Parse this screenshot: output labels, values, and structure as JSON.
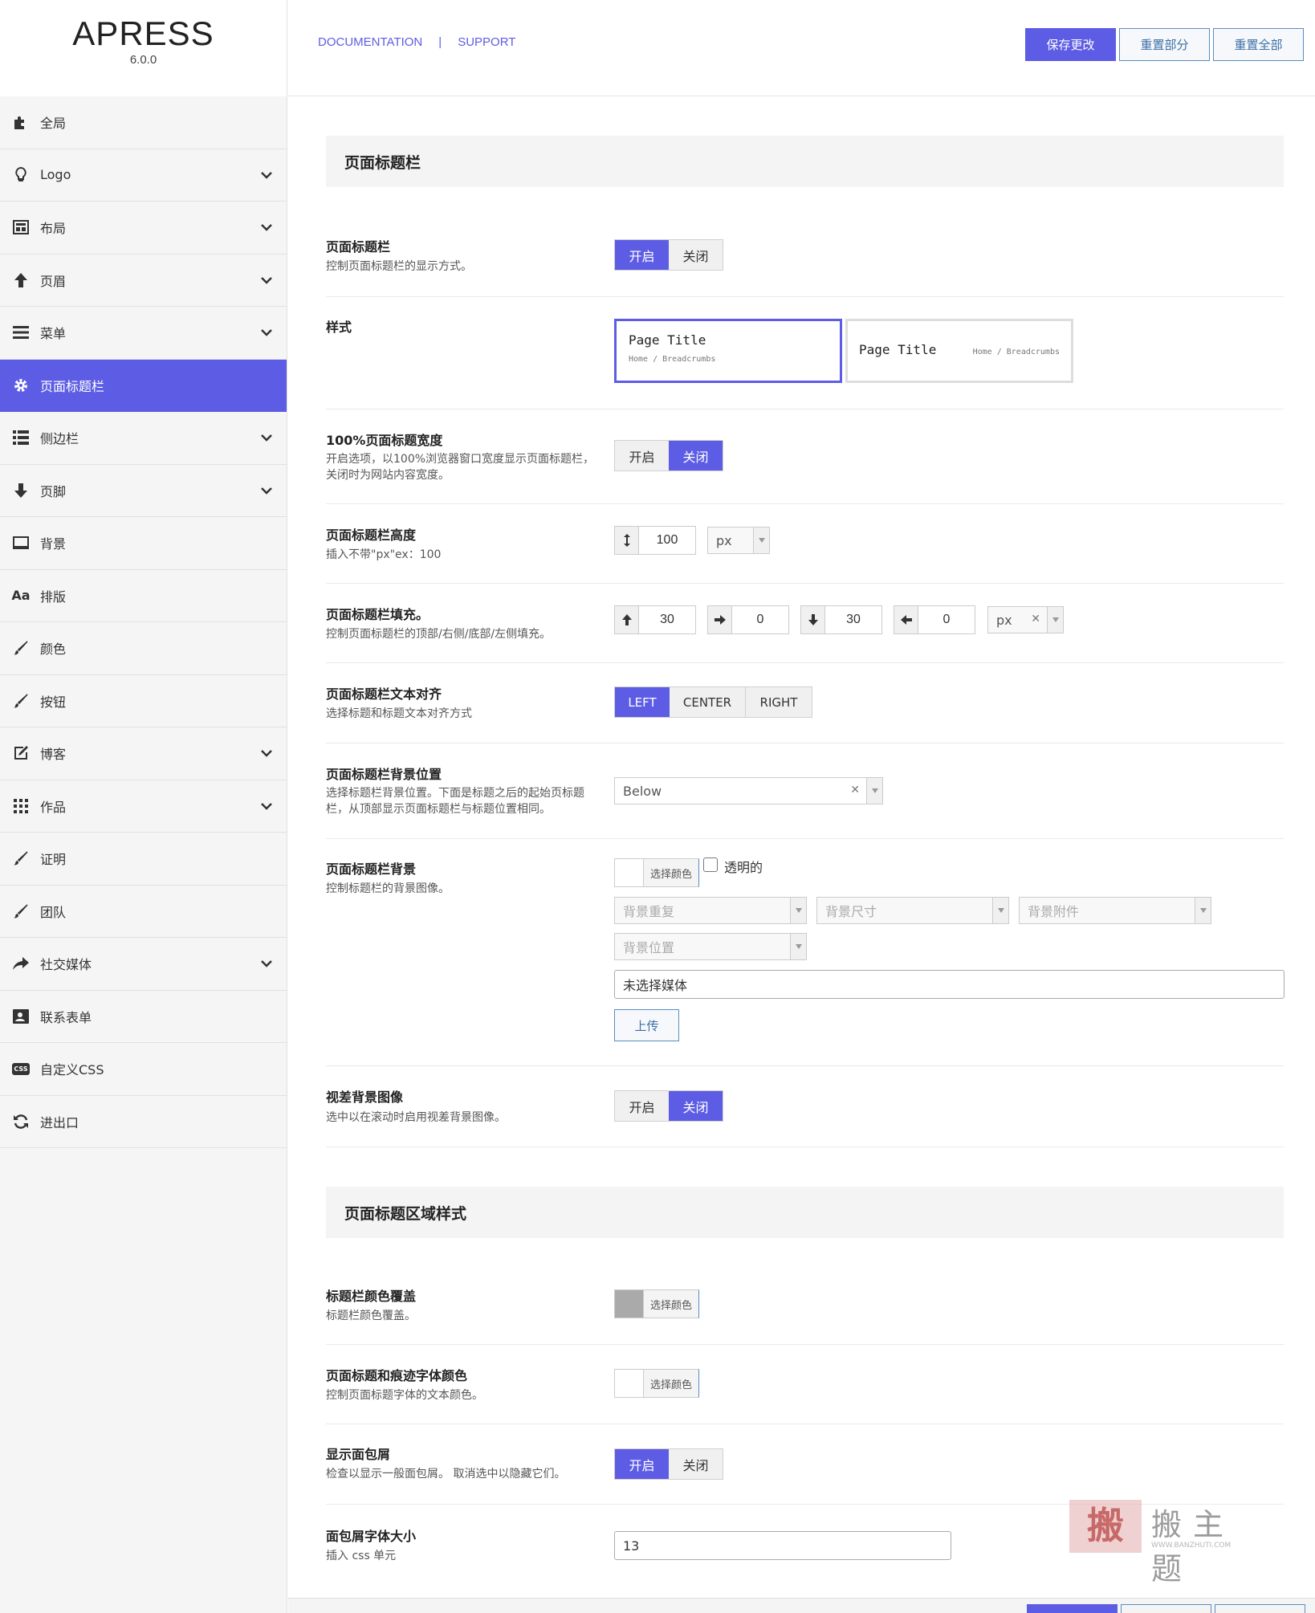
{
  "app": {
    "logo": "APRESS",
    "version": "6.0.0"
  },
  "sidebar": {
    "items": [
      {
        "label": "全局",
        "icon": "puzzle-icon",
        "chevron": false
      },
      {
        "label": "Logo",
        "icon": "lightbulb-icon",
        "chevron": true
      },
      {
        "label": "布局",
        "icon": "layout-icon",
        "chevron": true
      },
      {
        "label": "页眉",
        "icon": "arrow-up-icon",
        "chevron": true
      },
      {
        "label": "菜单",
        "icon": "menu-icon",
        "chevron": true
      },
      {
        "label": "页面标题栏",
        "icon": "gear-icon",
        "chevron": false,
        "active": true
      },
      {
        "label": "侧边栏",
        "icon": "list-icon",
        "chevron": true
      },
      {
        "label": "页脚",
        "icon": "arrow-down-icon",
        "chevron": true
      },
      {
        "label": "背景",
        "icon": "monitor-icon",
        "chevron": false
      },
      {
        "label": "排版",
        "icon": "typography-icon",
        "chevron": false,
        "icon_text": "Aa"
      },
      {
        "label": "颜色",
        "icon": "brush-icon",
        "chevron": false
      },
      {
        "label": "按钮",
        "icon": "brush-icon",
        "chevron": false
      },
      {
        "label": "博客",
        "icon": "edit-icon",
        "chevron": true
      },
      {
        "label": "作品",
        "icon": "grid-icon",
        "chevron": true
      },
      {
        "label": "证明",
        "icon": "brush-icon",
        "chevron": false
      },
      {
        "label": "团队",
        "icon": "brush-icon",
        "chevron": false
      },
      {
        "label": "社交媒体",
        "icon": "share-icon",
        "chevron": true
      },
      {
        "label": "联系表单",
        "icon": "contact-card-icon",
        "chevron": false
      },
      {
        "label": "自定义CSS",
        "icon": "css-icon",
        "chevron": false,
        "icon_text": "CSS"
      },
      {
        "label": "进出口",
        "icon": "refresh-icon",
        "chevron": false
      }
    ]
  },
  "topbar": {
    "documentation": "DOCUMENTATION",
    "separator": "|",
    "support": "SUPPORT",
    "save": "保存更改",
    "reset_section": "重置部分",
    "reset_all": "重置全部"
  },
  "sections": {
    "page_title_bar": "页面标题栏",
    "page_title_area_style": "页面标题区域样式"
  },
  "options": {
    "ptb": {
      "title": "页面标题栏",
      "desc": "控制页面标题栏的显示方式。",
      "on": "开启",
      "off": "关闭"
    },
    "style": {
      "title": "样式",
      "preview_title": "Page Title",
      "preview_breadcrumb": "Home / Breadcrumbs"
    },
    "full_width": {
      "title": "100%页面标题宽度",
      "desc": "开启选项，以100%浏览器窗口宽度显示页面标题栏，关闭时为网站内容宽度。",
      "on": "开启",
      "off": "关闭"
    },
    "height": {
      "title": "页面标题栏高度",
      "desc": "插入不带\"px\"ex：100",
      "value": "100",
      "unit": "px"
    },
    "padding": {
      "title": "页面标题栏填充。",
      "desc": "控制页面标题栏的顶部/右侧/底部/左侧填充。",
      "top": "30",
      "right": "0",
      "bottom": "30",
      "left": "0",
      "unit": "px"
    },
    "align": {
      "title": "页面标题栏文本对齐",
      "desc": "选择标题和标题文本对齐方式",
      "left": "LEFT",
      "center": "CENTER",
      "right": "RIGHT"
    },
    "bg_position": {
      "title": "页面标题栏背景位置",
      "desc": "选择标题栏背景位置。下面是标题之后的起始页标题栏，从顶部显示页面标题栏与标题位置相同。",
      "value": "Below"
    },
    "bg": {
      "title": "页面标题栏背景",
      "desc": "控制标题栏的背景图像。",
      "pick_color": "选择颜色",
      "transparent": "透明的",
      "repeat": "背景重复",
      "size": "背景尺寸",
      "attachment": "背景附件",
      "position": "背景位置",
      "media": "未选择媒体",
      "upload": "上传"
    },
    "parallax": {
      "title": "视差背景图像",
      "desc": "选中以在滚动时启用视差背景图像。",
      "on": "开启",
      "off": "关闭"
    },
    "overlay": {
      "title": "标题栏颜色覆盖",
      "desc": "标题栏颜色覆盖。",
      "pick_color": "选择颜色"
    },
    "font_color": {
      "title": "页面标题和痕迹字体颜色",
      "desc": "控制页面标题字体的文本颜色。",
      "pick_color": "选择颜色"
    },
    "breadcrumbs": {
      "title": "显示面包屑",
      "desc": "检查以显示一般面包屑。 取消选中以隐藏它们。",
      "on": "开启",
      "off": "关闭"
    },
    "bc_font_size": {
      "title": "面包屑字体大小",
      "desc": "插入 css 单元",
      "value": "13"
    }
  },
  "watermark": {
    "text": "搬主题",
    "url": "WWW.BANZHUTI.COM"
  },
  "colors": {
    "accent": "#5d5ce4",
    "link_border": "#5a8ec0",
    "overlay_swatch": "#aaaaaa"
  }
}
